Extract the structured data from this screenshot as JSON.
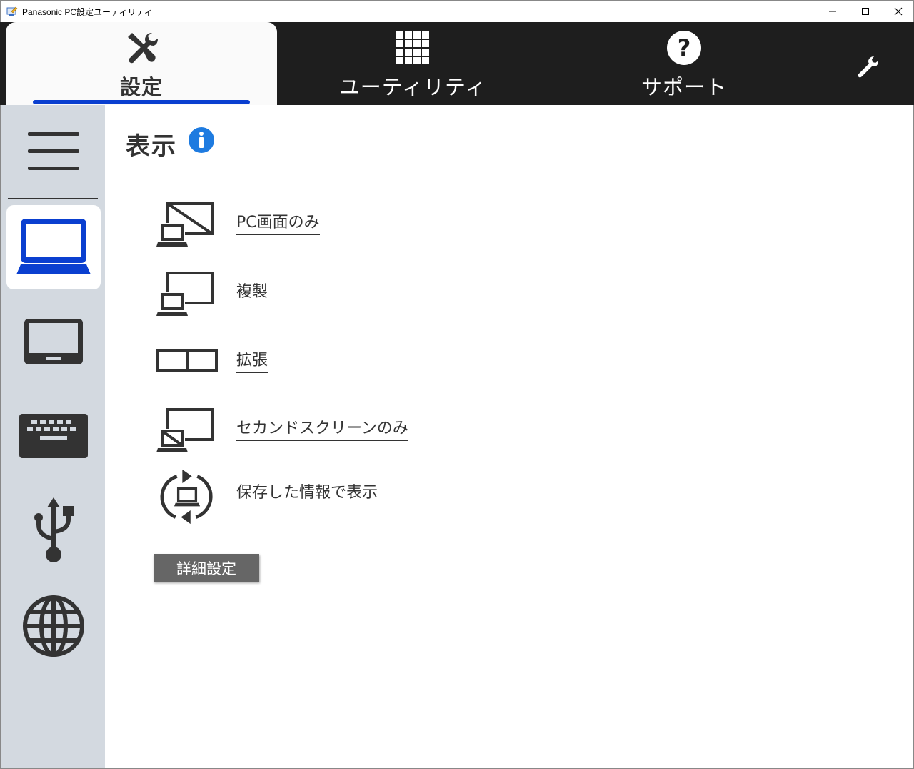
{
  "window": {
    "title": "Panasonic PC設定ユーティリティ"
  },
  "topnav": {
    "tabs": [
      {
        "label": "設定",
        "icon": "tools-icon",
        "active": true
      },
      {
        "label": "ユーティリティ",
        "icon": "grid-icon",
        "active": false
      },
      {
        "label": "サポート",
        "icon": "help-icon",
        "active": false
      }
    ],
    "wrench_icon": "wrench-icon"
  },
  "sidebar": {
    "menu_icon": "hamburger-menu-icon",
    "items": [
      {
        "name": "laptop",
        "icon": "laptop-icon",
        "active": true
      },
      {
        "name": "tablet",
        "icon": "tablet-icon",
        "active": false
      },
      {
        "name": "keyboard",
        "icon": "keyboard-icon",
        "active": false
      },
      {
        "name": "usb",
        "icon": "usb-icon",
        "active": false
      },
      {
        "name": "network",
        "icon": "globe-icon",
        "active": false
      }
    ]
  },
  "main": {
    "title": "表示",
    "options": [
      {
        "label": "PC画面のみ",
        "icon": "pc-screen-only-icon"
      },
      {
        "label": "複製",
        "icon": "duplicate-display-icon"
      },
      {
        "label": "拡張",
        "icon": "extend-display-icon"
      },
      {
        "label": "セカンドスクリーンのみ",
        "icon": "second-screen-only-icon"
      },
      {
        "label": "保存した情報で表示",
        "icon": "restore-saved-display-icon"
      }
    ],
    "advanced_button": "詳細設定"
  },
  "colors": {
    "accent": "#0a3fd0",
    "nav_bg": "#1e1e1e",
    "sidebar_bg": "#d3d9e0",
    "icon_dark": "#333333",
    "info_blue": "#1e7be0",
    "button_gray": "#666666"
  }
}
